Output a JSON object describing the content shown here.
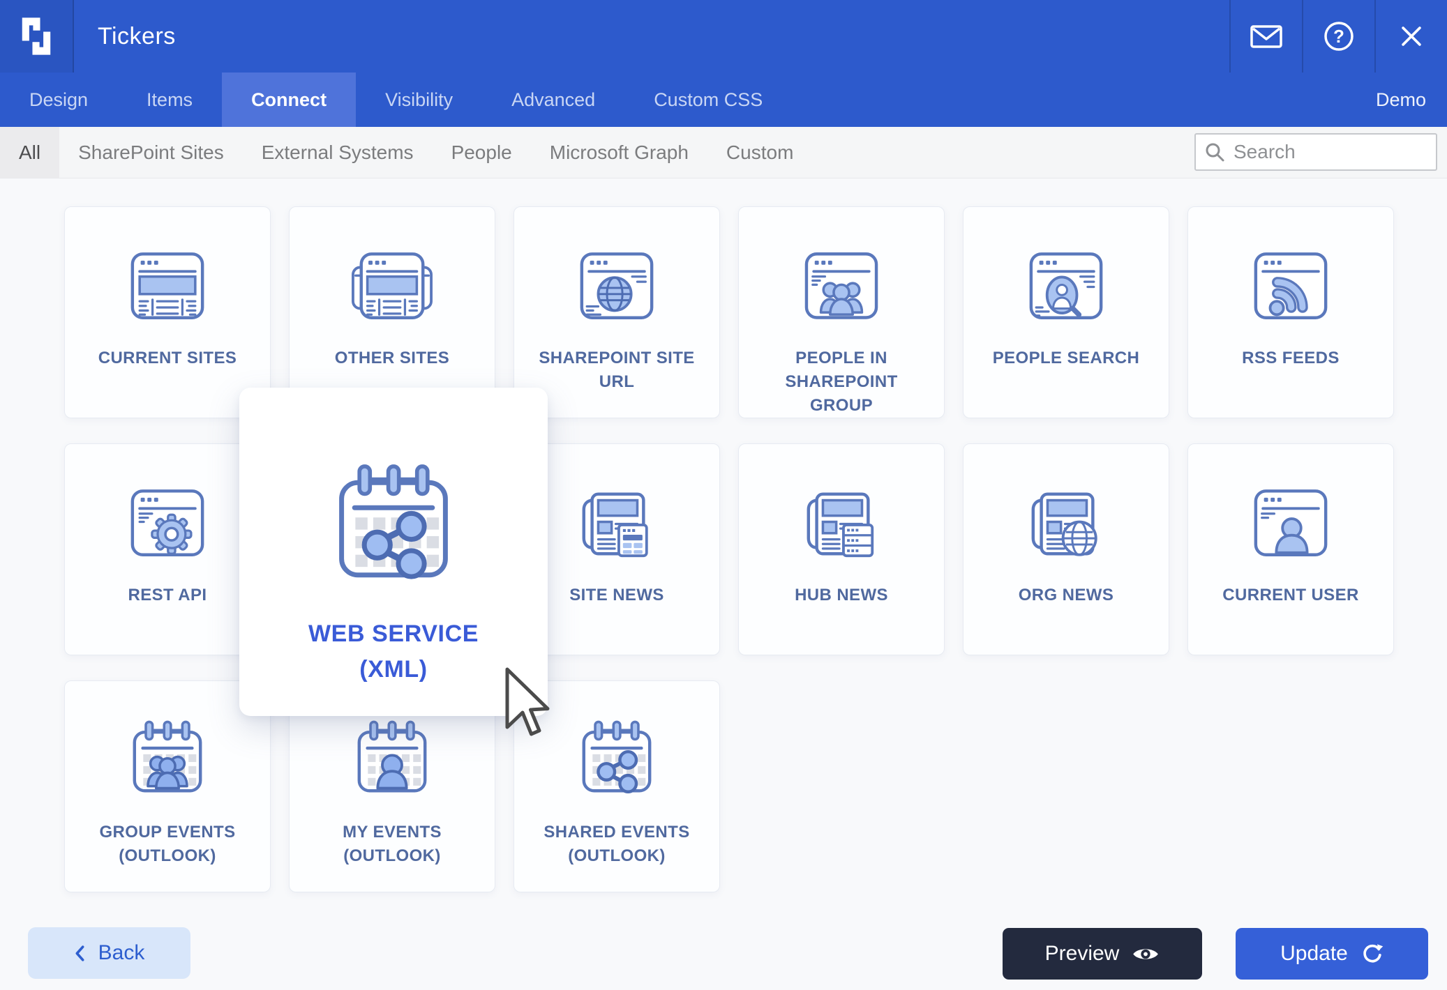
{
  "header": {
    "title": "Tickers"
  },
  "tabs": {
    "items": [
      {
        "label": "Design"
      },
      {
        "label": "Items"
      },
      {
        "label": "Connect",
        "active": true
      },
      {
        "label": "Visibility"
      },
      {
        "label": "Advanced"
      },
      {
        "label": "Custom CSS"
      }
    ],
    "right_label": "Demo"
  },
  "filters": {
    "items": [
      {
        "label": "All",
        "active": true
      },
      {
        "label": "SharePoint Sites"
      },
      {
        "label": "External Systems"
      },
      {
        "label": "People"
      },
      {
        "label": "Microsoft Graph"
      },
      {
        "label": "Custom"
      }
    ]
  },
  "search": {
    "placeholder": "Search"
  },
  "connectors": {
    "grid": [
      {
        "label": "CURRENT SITES",
        "icon": "browser-news"
      },
      {
        "label": "OTHER SITES",
        "icon": "browser-stack"
      },
      {
        "label": "SHAREPOINT SITE URL",
        "icon": "browser-globe"
      },
      {
        "label": "PEOPLE IN SHAREPOINT GROUP",
        "icon": "browser-people"
      },
      {
        "label": "PEOPLE SEARCH",
        "icon": "browser-person-search"
      },
      {
        "label": "RSS FEEDS",
        "icon": "browser-rss"
      },
      {
        "label": "REST API",
        "icon": "browser-gear"
      },
      {
        "empty": true
      },
      {
        "label": "SITE NEWS",
        "icon": "newspaper-panel"
      },
      {
        "label": "HUB NEWS",
        "icon": "newspaper-server"
      },
      {
        "label": "ORG NEWS",
        "icon": "newspaper-globe"
      },
      {
        "label": "CURRENT USER",
        "icon": "browser-user"
      },
      {
        "label": "GROUP EVENTS (OUTLOOK)",
        "icon": "calendar-people"
      },
      {
        "label": "MY EVENTS (OUTLOOK)",
        "icon": "calendar-person"
      },
      {
        "label": "SHARED EVENTS (OUTLOOK)",
        "icon": "calendar-share"
      }
    ],
    "hover_card": {
      "label": "WEB SERVICE (XML)",
      "icon": "calendar-share"
    }
  },
  "footer": {
    "back_label": "Back",
    "preview_label": "Preview",
    "update_label": "Update"
  },
  "colors": {
    "header_blue": "#2d5acc",
    "active_tab_blue": "#4f73da",
    "card_label_blue": "#50699f",
    "hover_label_blue": "#3a5bd7",
    "icon_stroke": "#5a78bc",
    "icon_fill_light": "#a9c3f1",
    "icon_fill_mid": "#8fb0ee",
    "back_button_bg": "#d8e6fa",
    "preview_button_bg": "#232a3e",
    "update_button_bg": "#3560d8"
  }
}
